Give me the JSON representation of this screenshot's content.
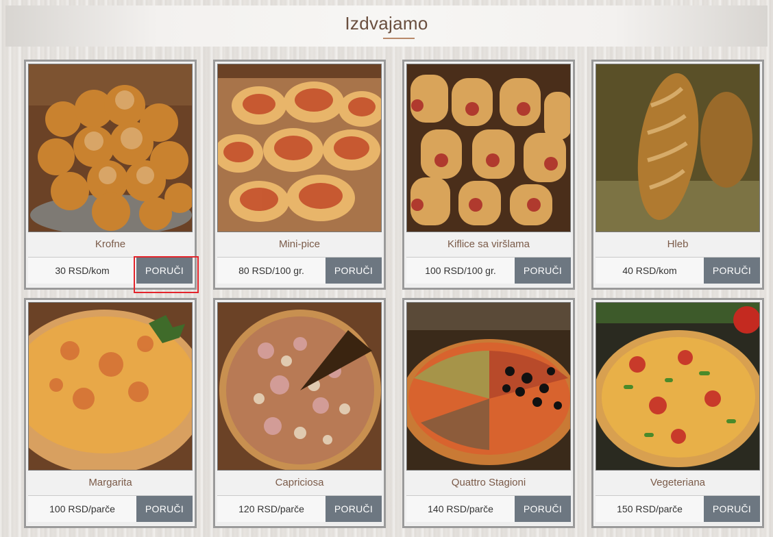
{
  "section": {
    "title": "Izdvajamo"
  },
  "products": [
    {
      "name": "Krofne",
      "price": "30 RSD/kom",
      "order_label": "PORUČI",
      "image": "donuts"
    },
    {
      "name": "Mini-pice",
      "price": "80 RSD/100 gr.",
      "order_label": "PORUČI",
      "image": "mini-pizzas"
    },
    {
      "name": "Kiflice sa viršlama",
      "price": "100 RSD/100 gr.",
      "order_label": "PORUČI",
      "image": "sausage-rolls"
    },
    {
      "name": "Hleb",
      "price": "40 RSD/kom",
      "order_label": "PORUČI",
      "image": "bread"
    },
    {
      "name": "Margarita",
      "price": "100 RSD/parče",
      "order_label": "PORUČI",
      "image": "pizza-margarita"
    },
    {
      "name": "Capriciosa",
      "price": "120 RSD/parče",
      "order_label": "PORUČI",
      "image": "pizza-capriciosa"
    },
    {
      "name": "Quattro Stagioni",
      "price": "140 RSD/parče",
      "order_label": "PORUČI",
      "image": "pizza-quattro-stagioni"
    },
    {
      "name": "Vegeteriana",
      "price": "150 RSD/parče",
      "order_label": "PORUČI",
      "image": "pizza-vegeteriana"
    }
  ],
  "colors": {
    "order_button": "#6d7781",
    "product_name": "#7a5a48",
    "highlight": "#e3242b"
  }
}
